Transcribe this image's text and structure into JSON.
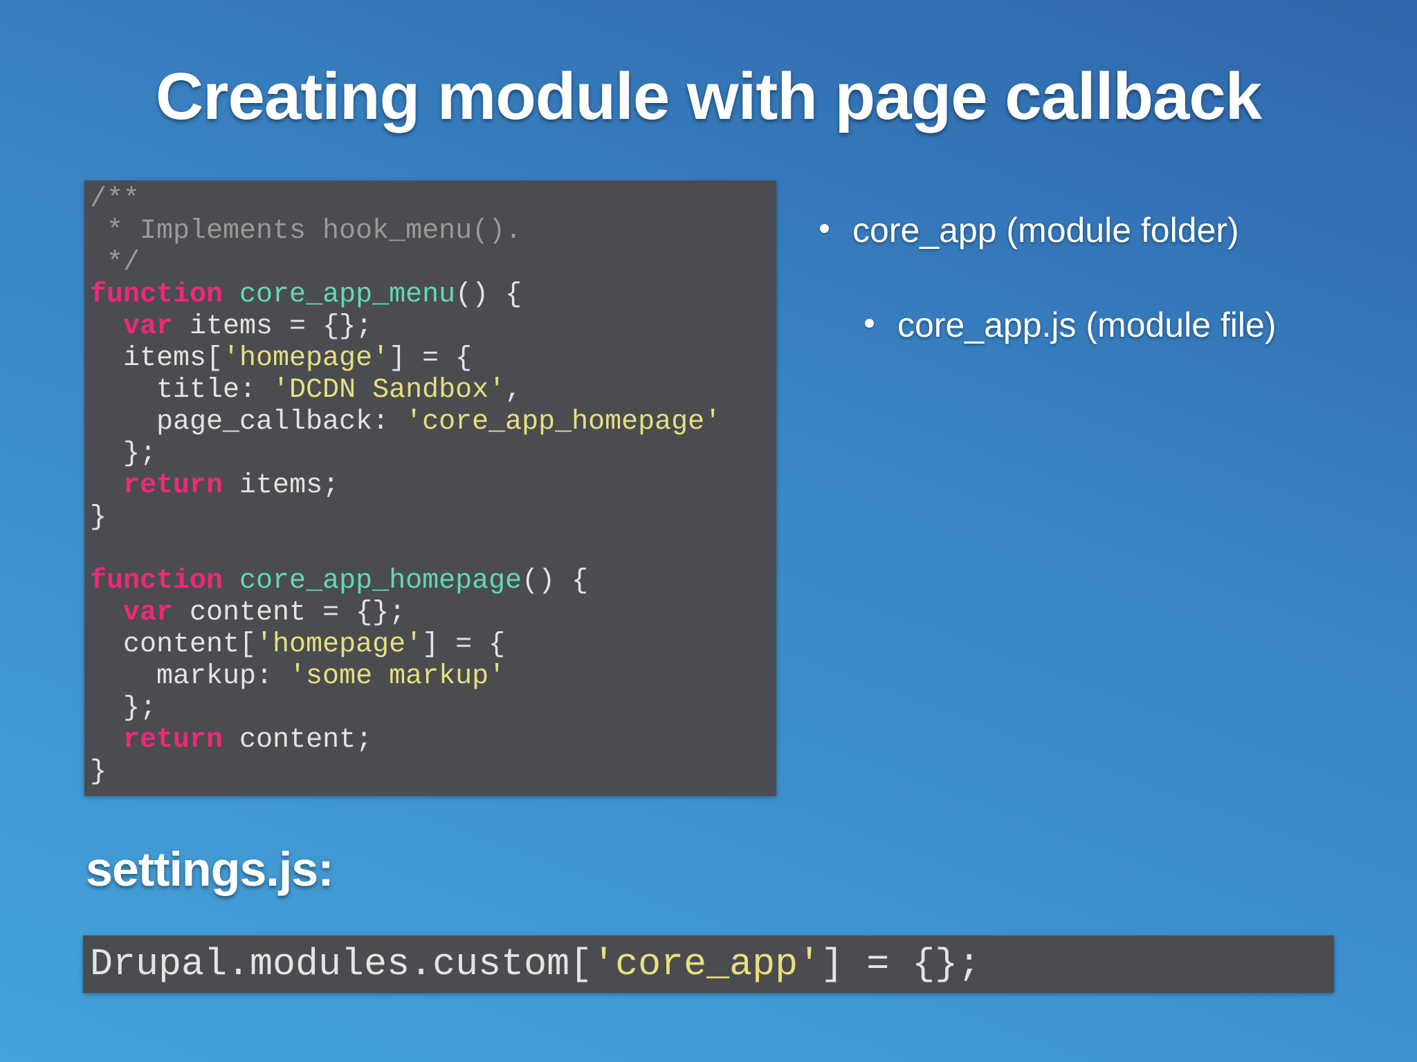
{
  "slide": {
    "title": "Creating module with page callback",
    "settings_label": "settings.js:"
  },
  "code_block": {
    "lines": [
      [
        {
          "type": "comment",
          "text": "/**"
        }
      ],
      [
        {
          "type": "comment",
          "text": " * Implements hook_menu()."
        }
      ],
      [
        {
          "type": "comment",
          "text": " */"
        }
      ],
      [
        {
          "type": "keyword",
          "text": "function"
        },
        {
          "type": "plain",
          "text": " "
        },
        {
          "type": "fn",
          "text": "core_app_menu"
        },
        {
          "type": "plain",
          "text": "() {"
        }
      ],
      [
        {
          "type": "plain",
          "text": "  "
        },
        {
          "type": "keyword",
          "text": "var"
        },
        {
          "type": "plain",
          "text": " items = {};"
        }
      ],
      [
        {
          "type": "plain",
          "text": "  items["
        },
        {
          "type": "str",
          "text": "'homepage'"
        },
        {
          "type": "plain",
          "text": "] = {"
        }
      ],
      [
        {
          "type": "plain",
          "text": "    title: "
        },
        {
          "type": "str",
          "text": "'DCDN Sandbox'"
        },
        {
          "type": "plain",
          "text": ","
        }
      ],
      [
        {
          "type": "plain",
          "text": "    page_callback: "
        },
        {
          "type": "str",
          "text": "'core_app_homepage'"
        }
      ],
      [
        {
          "type": "plain",
          "text": "  };"
        }
      ],
      [
        {
          "type": "plain",
          "text": "  "
        },
        {
          "type": "keyword",
          "text": "return"
        },
        {
          "type": "plain",
          "text": " items;"
        }
      ],
      [
        {
          "type": "plain",
          "text": "}"
        }
      ],
      [
        {
          "type": "plain",
          "text": ""
        }
      ],
      [
        {
          "type": "keyword",
          "text": "function"
        },
        {
          "type": "plain",
          "text": " "
        },
        {
          "type": "fn",
          "text": "core_app_homepage"
        },
        {
          "type": "plain",
          "text": "() {"
        }
      ],
      [
        {
          "type": "plain",
          "text": "  "
        },
        {
          "type": "keyword",
          "text": "var"
        },
        {
          "type": "plain",
          "text": " content = {};"
        }
      ],
      [
        {
          "type": "plain",
          "text": "  content["
        },
        {
          "type": "str",
          "text": "'homepage'"
        },
        {
          "type": "plain",
          "text": "] = {"
        }
      ],
      [
        {
          "type": "plain",
          "text": "    markup: "
        },
        {
          "type": "str",
          "text": "'some markup'"
        }
      ],
      [
        {
          "type": "plain",
          "text": "  };"
        }
      ],
      [
        {
          "type": "plain",
          "text": "  "
        },
        {
          "type": "keyword",
          "text": "return"
        },
        {
          "type": "plain",
          "text": " content;"
        }
      ],
      [
        {
          "type": "plain",
          "text": "}"
        }
      ]
    ]
  },
  "bullets": [
    {
      "text": "core_app (module folder)",
      "level": 1
    },
    {
      "text": "core_app.js (module file)",
      "level": 2
    }
  ],
  "settings_code": [
    {
      "type": "plain",
      "text": "Drupal.modules.custom["
    },
    {
      "type": "str",
      "text": "'core_app'"
    },
    {
      "type": "plain",
      "text": "] = {};"
    }
  ],
  "colors": {
    "background_top": "#2f66ab",
    "background_bottom": "#45a2da",
    "code_bg": "#4b4c4f",
    "keyword": "#f0287a",
    "function_name": "#62d9b4",
    "string": "#e6e080",
    "comment": "#9a9a9a",
    "plain": "#e4e4e4"
  }
}
